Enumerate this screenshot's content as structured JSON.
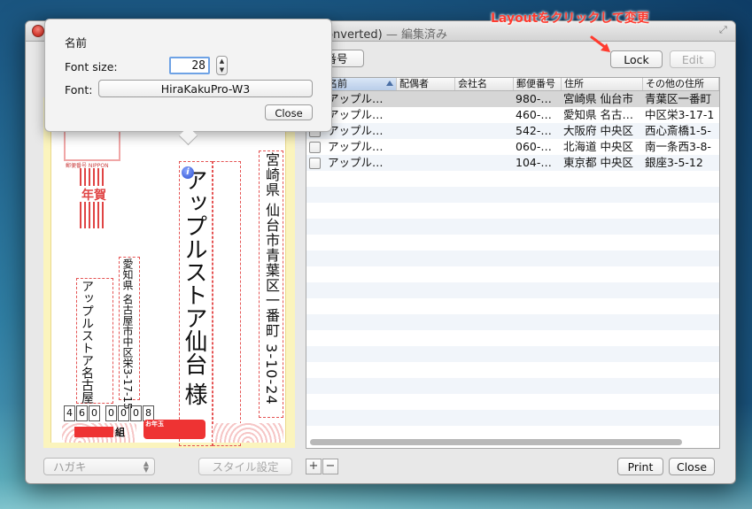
{
  "window": {
    "title": "Converted)",
    "status": "— 編集済み"
  },
  "annotation": {
    "text": "Layoutをクリックして変更"
  },
  "toolbar": {
    "partial_button": "番号",
    "lock_label": "Lock",
    "edit_label": "Edit"
  },
  "popover": {
    "title": "名前",
    "font_size_label": "Font size:",
    "font_size_value": "28",
    "font_label": "Font:",
    "font_value": "HiraKakuPro-W3",
    "close_label": "Close"
  },
  "card": {
    "recipient_address": "宮崎県 仙台市青葉区一番町 3-10-24",
    "recipient_name": "アップルストア仙台 様",
    "sender_address": "愛知県 名古屋市中区栄3-17-15",
    "sender_name": "アップルストア名古屋",
    "sender_zip": [
      "4",
      "6",
      "0",
      "0",
      "0",
      "0",
      "8"
    ],
    "nenga_text": "年賀",
    "stamp_text": "郵便番号 NIPPON",
    "otoshidama_text": "お年玉",
    "kumi_text": "組"
  },
  "table": {
    "headers": [
      "名前",
      "配偶者",
      "会社名",
      "郵便番号",
      "住所",
      "その他の住所"
    ],
    "rows": [
      [
        "アップル…",
        "",
        "",
        "980-…",
        "宮崎県 仙台市",
        "青葉区一番町"
      ],
      [
        "アップル…",
        "",
        "",
        "460-…",
        "愛知県 名古…",
        "中区栄3-17-1"
      ],
      [
        "アップル…",
        "",
        "",
        "542-…",
        "大阪府 中央区",
        "西心斎橋1-5-"
      ],
      [
        "アップル…",
        "",
        "",
        "060-…",
        "北海道 中央区",
        "南一条西3-8-"
      ],
      [
        "アップル…",
        "",
        "",
        "104-…",
        "東京都 中央区",
        "銀座3-5-12"
      ]
    ]
  },
  "bottom": {
    "paper_select": "ハガキ",
    "style_button": "スタイル設定",
    "add_label": "+",
    "remove_label": "−",
    "print_label": "Print",
    "close_label": "Close"
  },
  "colors": {
    "annotation": "#ff3b2f",
    "guide_dash": "#e55353",
    "card_border": "#fbf4bd",
    "selected_row": "#d6d6d6",
    "focus_ring": "#6ea2e5"
  }
}
